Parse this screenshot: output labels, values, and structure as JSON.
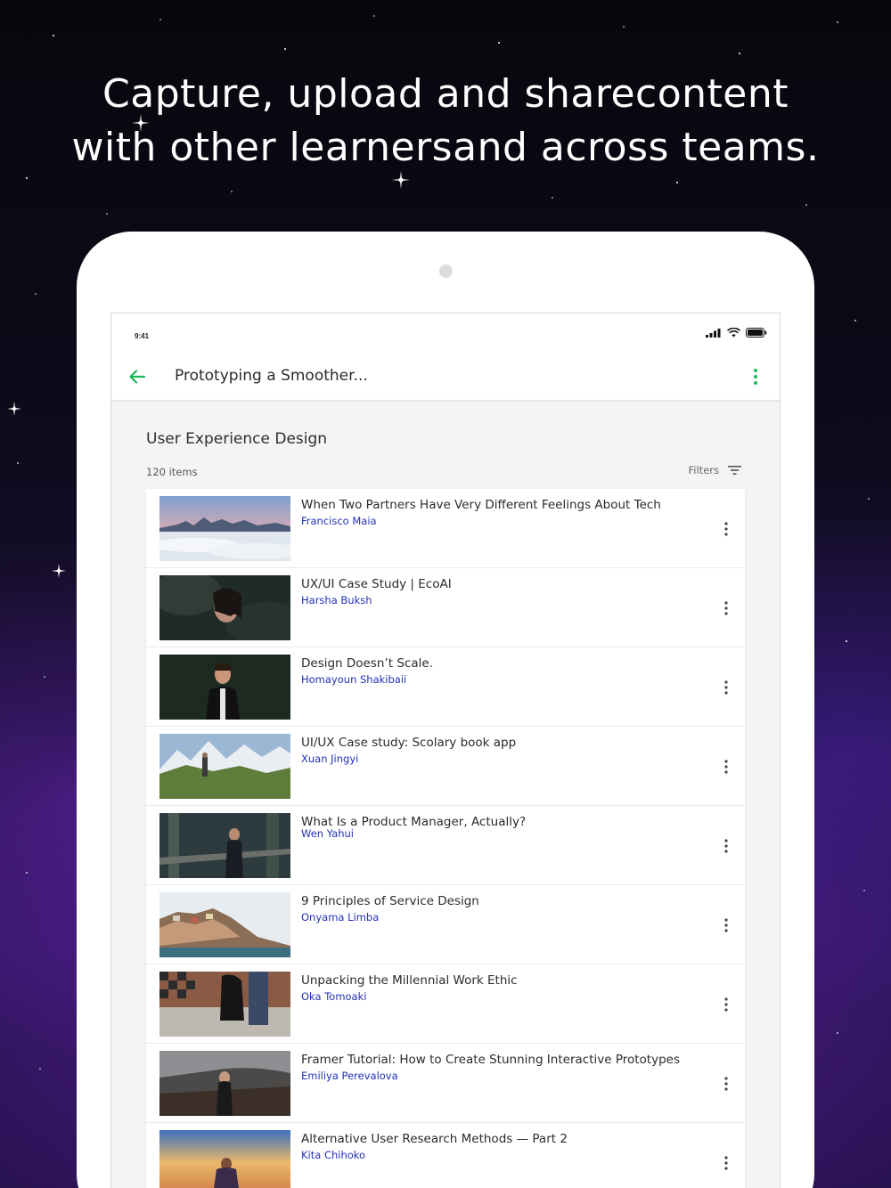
{
  "headline": {
    "line1": "Capture, upload and sharecontent",
    "line2": "with other learnersand across teams."
  },
  "status_bar": {
    "time": "9:41"
  },
  "app_bar": {
    "title": "Prototyping a Smoother..."
  },
  "section": {
    "title": "User Experience Design",
    "count": "120 items",
    "filters_label": "Filters"
  },
  "colors": {
    "accent_green": "#1db954",
    "author_blue": "#2230b8"
  },
  "items": [
    {
      "title": "When Two Partners Have Very Different Feelings About Tech",
      "author": "Francisco Maia"
    },
    {
      "title": "UX/UI Case Study | EcoAI",
      "author": "Harsha Buksh"
    },
    {
      "title": "Design Doesn’t Scale.",
      "author": "Homayoun Shakibaii"
    },
    {
      "title": "UI/UX Case study: Scolary book app",
      "author": "Xuan Jingyi"
    },
    {
      "title": "What Is a Product Manager, Actually?",
      "author": "Wen Yahui"
    },
    {
      "title": "9 Principles of Service Design",
      "author": "Onyama Limba"
    },
    {
      "title": "Unpacking the Millennial Work Ethic",
      "author": "Oka Tomoaki"
    },
    {
      "title": "Framer Tutorial: How to Create Stunning Interactive Prototypes",
      "author": "Emiliya Perevalova"
    },
    {
      "title": "Alternative User Research Methods — Part 2",
      "author": "Kita Chihoko"
    }
  ]
}
